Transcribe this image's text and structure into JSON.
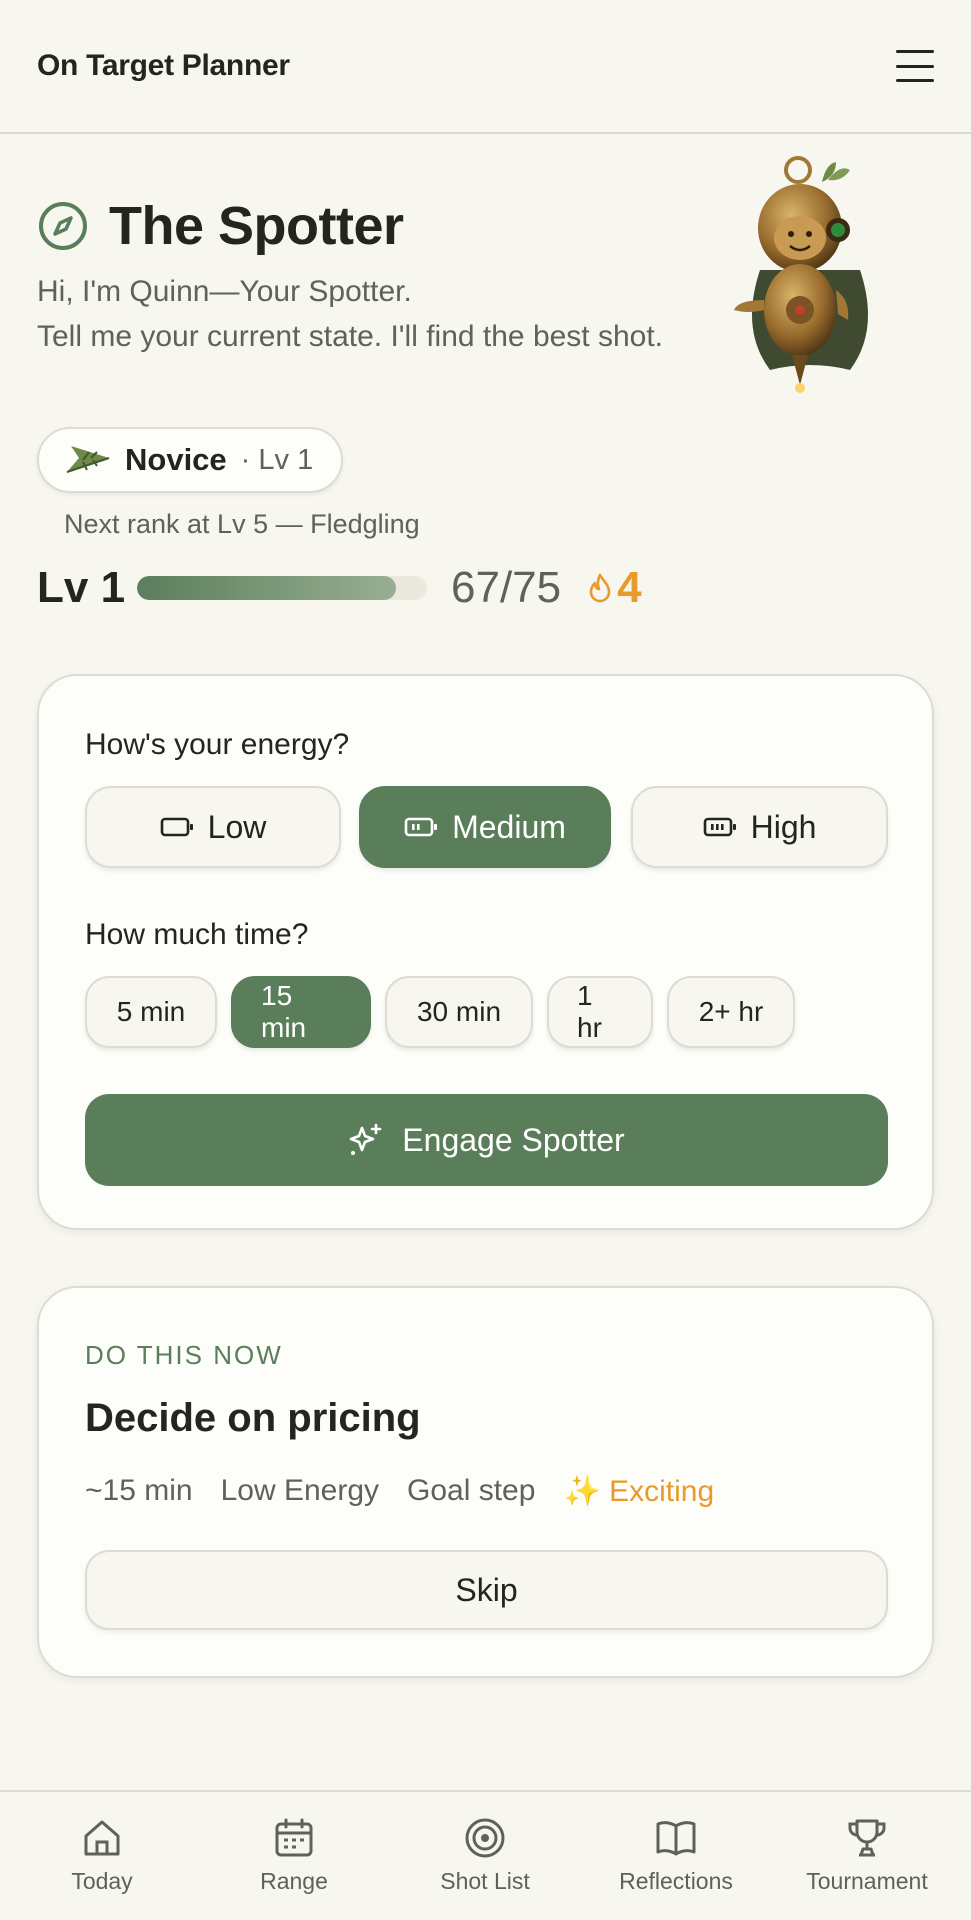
{
  "app": {
    "title": "On Target Planner"
  },
  "hero": {
    "title": "The Spotter",
    "subtitle_line1": "Hi, I'm Quinn—Your Spotter.",
    "subtitle_line2": "Tell me your current state. I'll find the best shot."
  },
  "rank": {
    "name": "Novice",
    "level_tag": "· Lv 1",
    "next_rank": "Next rank at Lv 5 — Fledgling"
  },
  "progress": {
    "level_label": "Lv 1",
    "xp_text": "67/75",
    "xp_fraction": 0.893,
    "streak": "4"
  },
  "energy": {
    "question": "How's your energy?",
    "options": [
      {
        "label": "Low",
        "icon": "battery-low-icon"
      },
      {
        "label": "Medium",
        "icon": "battery-medium-icon",
        "selected": true
      },
      {
        "label": "High",
        "icon": "battery-full-icon"
      }
    ]
  },
  "time": {
    "question": "How much time?",
    "options": [
      "5 min",
      "15 min",
      "30 min",
      "1 hr",
      "2+ hr"
    ],
    "selected": "15 min"
  },
  "engage_label": "Engage Spotter",
  "recommendation": {
    "eyebrow": "DO THIS NOW",
    "task": "Decide on pricing",
    "duration": "~15 min",
    "energy": "Low Energy",
    "type": "Goal step",
    "mood": "✨ Exciting",
    "skip_label": "Skip"
  },
  "tabs": [
    {
      "label": "Today",
      "icon": "home-icon"
    },
    {
      "label": "Range",
      "icon": "calendar-icon"
    },
    {
      "label": "Shot List",
      "icon": "target-icon"
    },
    {
      "label": "Reflections",
      "icon": "book-icon"
    },
    {
      "label": "Tournament",
      "icon": "trophy-icon"
    }
  ],
  "colors": {
    "accent": "#5a7d5a",
    "streak": "#e99a2c",
    "background": "#f7f6ef"
  }
}
